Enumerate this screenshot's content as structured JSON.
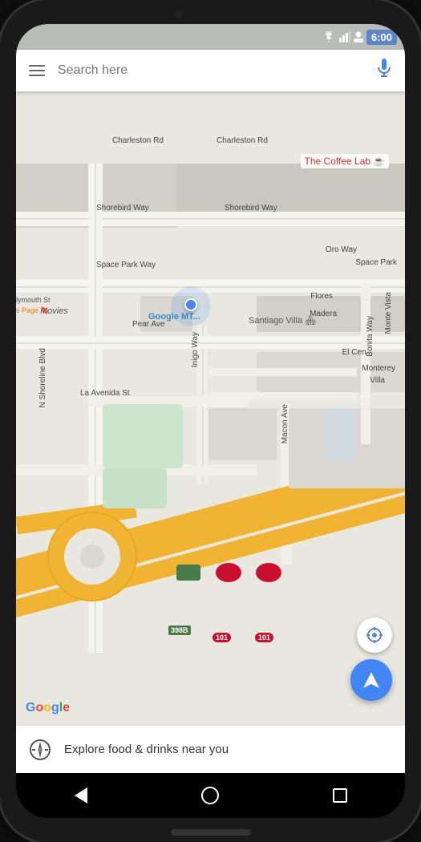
{
  "status_bar": {
    "time": "6:00",
    "signal_icon": "signal-icon",
    "wifi_icon": "wifi-icon",
    "user_icon": "user-icon"
  },
  "search": {
    "placeholder": "Search here",
    "mic_label": "mic-icon",
    "menu_label": "menu-icon"
  },
  "map": {
    "coffee_lab": {
      "name": "The Coffee Lab",
      "emoji": "☕"
    },
    "road_labels": [
      "Charleston Rd",
      "Charleston Rd",
      "Shorebird Way",
      "Shorebird Way",
      "Space Park Way",
      "Oro Way",
      "Space Park",
      "Flores",
      "Madera",
      "Pear Ave",
      "La Avenida St",
      "Macon Ave",
      "N Shoreline Blvd",
      "Bonita Way",
      "Monte Vista",
      "Monterey",
      "Villa",
      "El Cen...",
      "Santiago Villa",
      "Movies",
      "lymouth St",
      "s Page"
    ],
    "google_mt_label": "Google MT...",
    "highway_labels": [
      "398B",
      "101",
      "101"
    ],
    "google_logo": {
      "G": "G",
      "o1": "o",
      "o2": "o",
      "g": "g",
      "l": "l",
      "e": "e"
    }
  },
  "buttons": {
    "location_label": "location-button",
    "navigate_label": "navigate-button"
  },
  "bottom_panel": {
    "text": "Explore food & drinks near you",
    "icon": "compass-icon"
  },
  "android_nav": {
    "back": "back-button",
    "home": "home-button",
    "recent": "recent-button"
  }
}
